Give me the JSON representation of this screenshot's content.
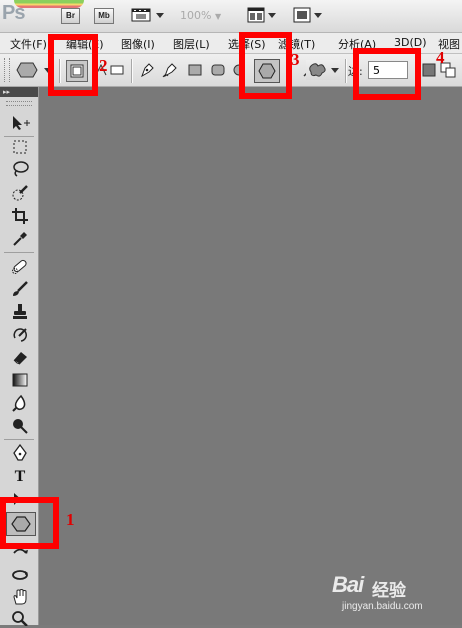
{
  "app": {
    "logo_text": "Ps",
    "bridge_label": "Br",
    "minibridge_label": "Mb",
    "zoom_level": "100%"
  },
  "menubar": {
    "items": [
      {
        "label": "文件(F)"
      },
      {
        "label": "编辑(E)"
      },
      {
        "label": "图像(I)"
      },
      {
        "label": "图层(L)"
      },
      {
        "label": "选择(S)"
      },
      {
        "label": "滤镜(T)"
      },
      {
        "label": "分析(A)"
      },
      {
        "label": "3D(D)"
      },
      {
        "label": "视图"
      }
    ]
  },
  "options_bar": {
    "sides_label": "边:",
    "sides_value": "5",
    "active_shape_tool": "polygon-tool"
  },
  "toolbox": {
    "header": "▸▸",
    "tools": [
      "move-tool",
      "marquee-tool",
      "lasso-tool",
      "quick-selection-tool",
      "crop-tool",
      "eyedropper-tool",
      "spot-healing-tool",
      "brush-tool",
      "clone-stamp-tool",
      "history-brush-tool",
      "eraser-tool",
      "gradient-tool",
      "blur-tool",
      "dodge-tool",
      "pen-tool",
      "type-tool",
      "path-selection-tool",
      "polygon-tool",
      "3d-rotate-tool",
      "3d-orbit-tool",
      "hand-tool",
      "zoom-tool"
    ],
    "active_tool": "polygon-tool"
  },
  "annotations": [
    {
      "label": "1"
    },
    {
      "label": "2"
    },
    {
      "label": "3"
    },
    {
      "label": "4"
    }
  ],
  "watermark": {
    "brand": "Bai",
    "brand_suffix": "经验",
    "url": "jingyan.baidu.com"
  },
  "colors": {
    "annotation_red": "#ff0000",
    "canvas_gray": "#797979",
    "toolbox_gray": "#d6d6d6"
  }
}
